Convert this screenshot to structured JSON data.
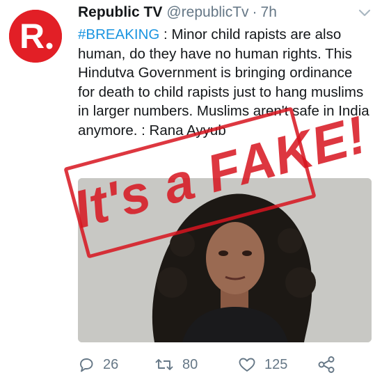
{
  "tweet": {
    "display_name": "Republic TV",
    "handle": "@republicTv",
    "separator": "·",
    "time": "7h",
    "avatar_letter": "R.",
    "hashtag": "#BREAKING",
    "body": " : Minor child rapists are also human, do they have no human rights. This Hindutva Government is bringing ordinance for death to child rapists just to hang muslims in larger numbers. Muslims aren't safe in India anymore. : Rana Ayyub"
  },
  "stamp": {
    "text": "It's a FAKE!"
  },
  "actions": {
    "replies": "26",
    "retweets": "80",
    "likes": "125"
  },
  "icons": {
    "caret": "chevron-down-icon",
    "reply": "reply-icon",
    "retweet": "retweet-icon",
    "like": "heart-icon",
    "share": "share-icon"
  },
  "colors": {
    "brand_red": "#e21f26",
    "hashtag_blue": "#1b95e0",
    "muted_gray": "#657786",
    "stamp_red": "#d7141e"
  }
}
